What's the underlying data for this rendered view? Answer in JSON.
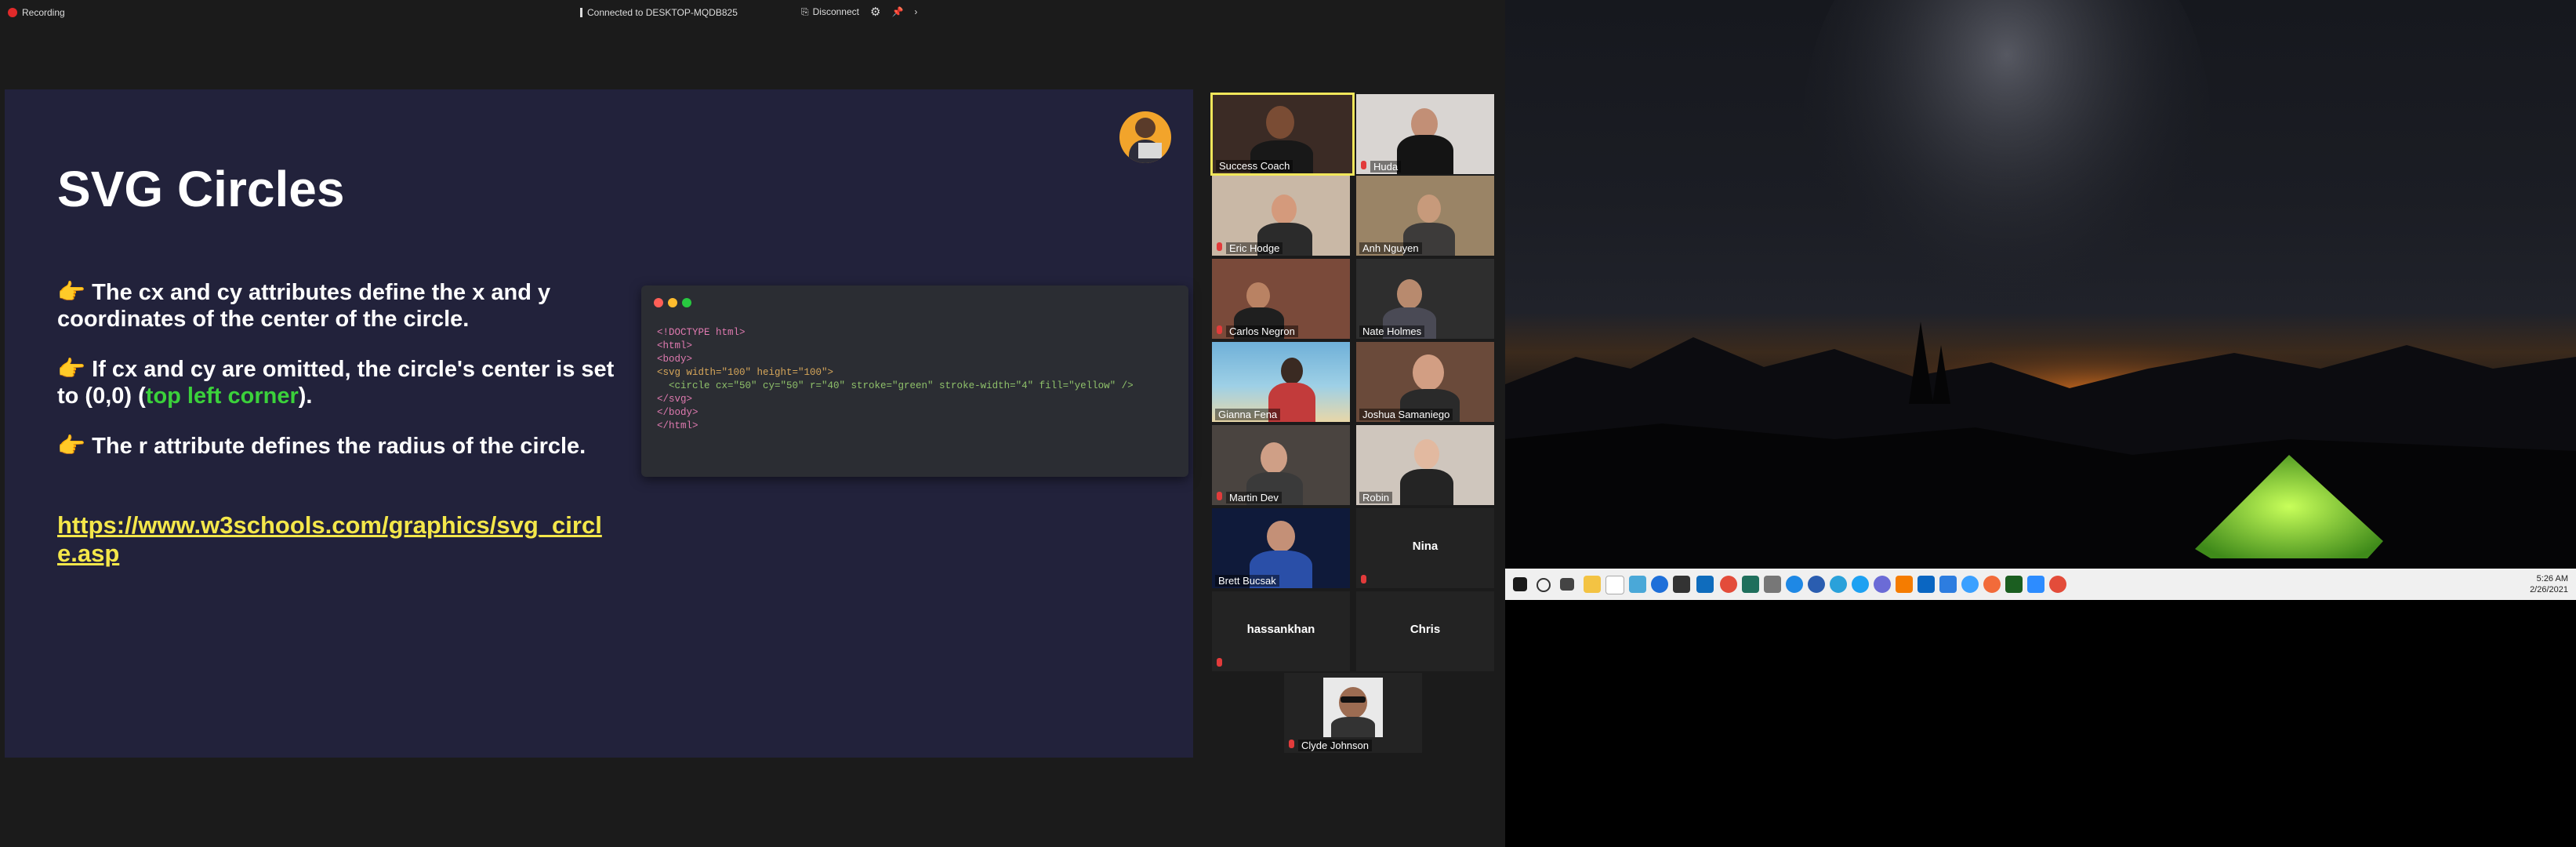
{
  "topbar": {
    "recording": "Recording",
    "connection": "Connected to DESKTOP-MQDB825",
    "disconnect": "Disconnect"
  },
  "slide": {
    "title": "SVG Circles",
    "bullet1": "👉 The cx and cy attributes define the x and y coordinates of the center of the circle.",
    "bullet2_pre": "👉 If cx and cy are omitted, the circle's center is set to (0,0) (",
    "bullet2_highlight": "top left corner",
    "bullet2_post": ").",
    "bullet3": "👉 The r attribute defines the radius of the circle.",
    "link": "https://www.w3schools.com/graphics/svg_circle.asp"
  },
  "code": {
    "line1": "<!DOCTYPE html>",
    "line2": "<html>",
    "line3": "<body>",
    "line4": "",
    "line5": "<svg width=\"100\" height=\"100\">",
    "line6": "  <circle cx=\"50\" cy=\"50\" r=\"40\" stroke=\"green\" stroke-width=\"4\" fill=\"yellow\" />",
    "line7": "</svg>",
    "line8": "",
    "line9": "</body>",
    "line10": "</html>"
  },
  "participants": [
    {
      "name": "Success Coach"
    },
    {
      "name": "Huda"
    },
    {
      "name": "Eric Hodge"
    },
    {
      "name": "Anh Nguyen"
    },
    {
      "name": "Carlos Negron"
    },
    {
      "name": "Nate Holmes"
    },
    {
      "name": "Gianna Fena"
    },
    {
      "name": "Joshua Samaniego"
    },
    {
      "name": "Martin Dev"
    },
    {
      "name": "Robin"
    },
    {
      "name": "Brett Bucsak"
    },
    {
      "name": "Nina"
    },
    {
      "name": "hassankhan"
    },
    {
      "name": "Chris"
    },
    {
      "name": "Clyde Johnson"
    }
  ],
  "taskbar": {
    "time": "5:26 AM",
    "date": "2/26/2021"
  },
  "colors": {
    "slide_bg": "#22223b",
    "highlight_green": "#3bd13b",
    "link_yellow": "#f4e74a",
    "active_speaker": "#f1e65a"
  }
}
